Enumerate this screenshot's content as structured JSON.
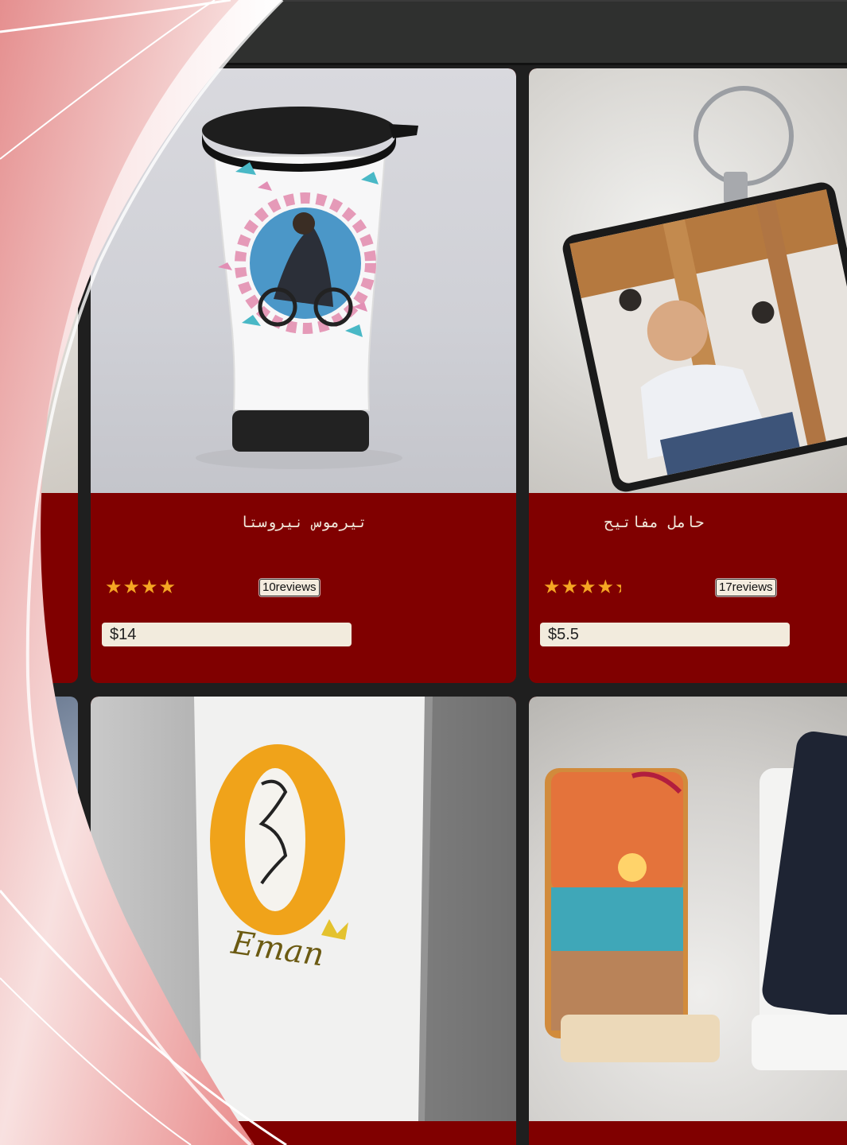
{
  "products": [
    {
      "title": "تيرموس نيروستا",
      "stars": "★★★★",
      "rating": 4,
      "reviews": "10reviews",
      "price": "$14",
      "image_icon": "thermos-mug-photo"
    },
    {
      "title": "حامل مفاتيح",
      "stars": "★★★★",
      "rating": 4.5,
      "reviews": "17reviews",
      "price": "$5.5",
      "image_icon": "photo-keychain-photo"
    },
    {
      "title": "",
      "image_icon": "printed-tote-bag-photo",
      "bag_print": "Eman"
    },
    {
      "title": "",
      "image_icon": "phone-stand-photo"
    }
  ],
  "colors": {
    "card_bg": "#800000",
    "topbar": "#2f302f",
    "star": "#f5a623",
    "price_field": "#f2ebdd"
  }
}
